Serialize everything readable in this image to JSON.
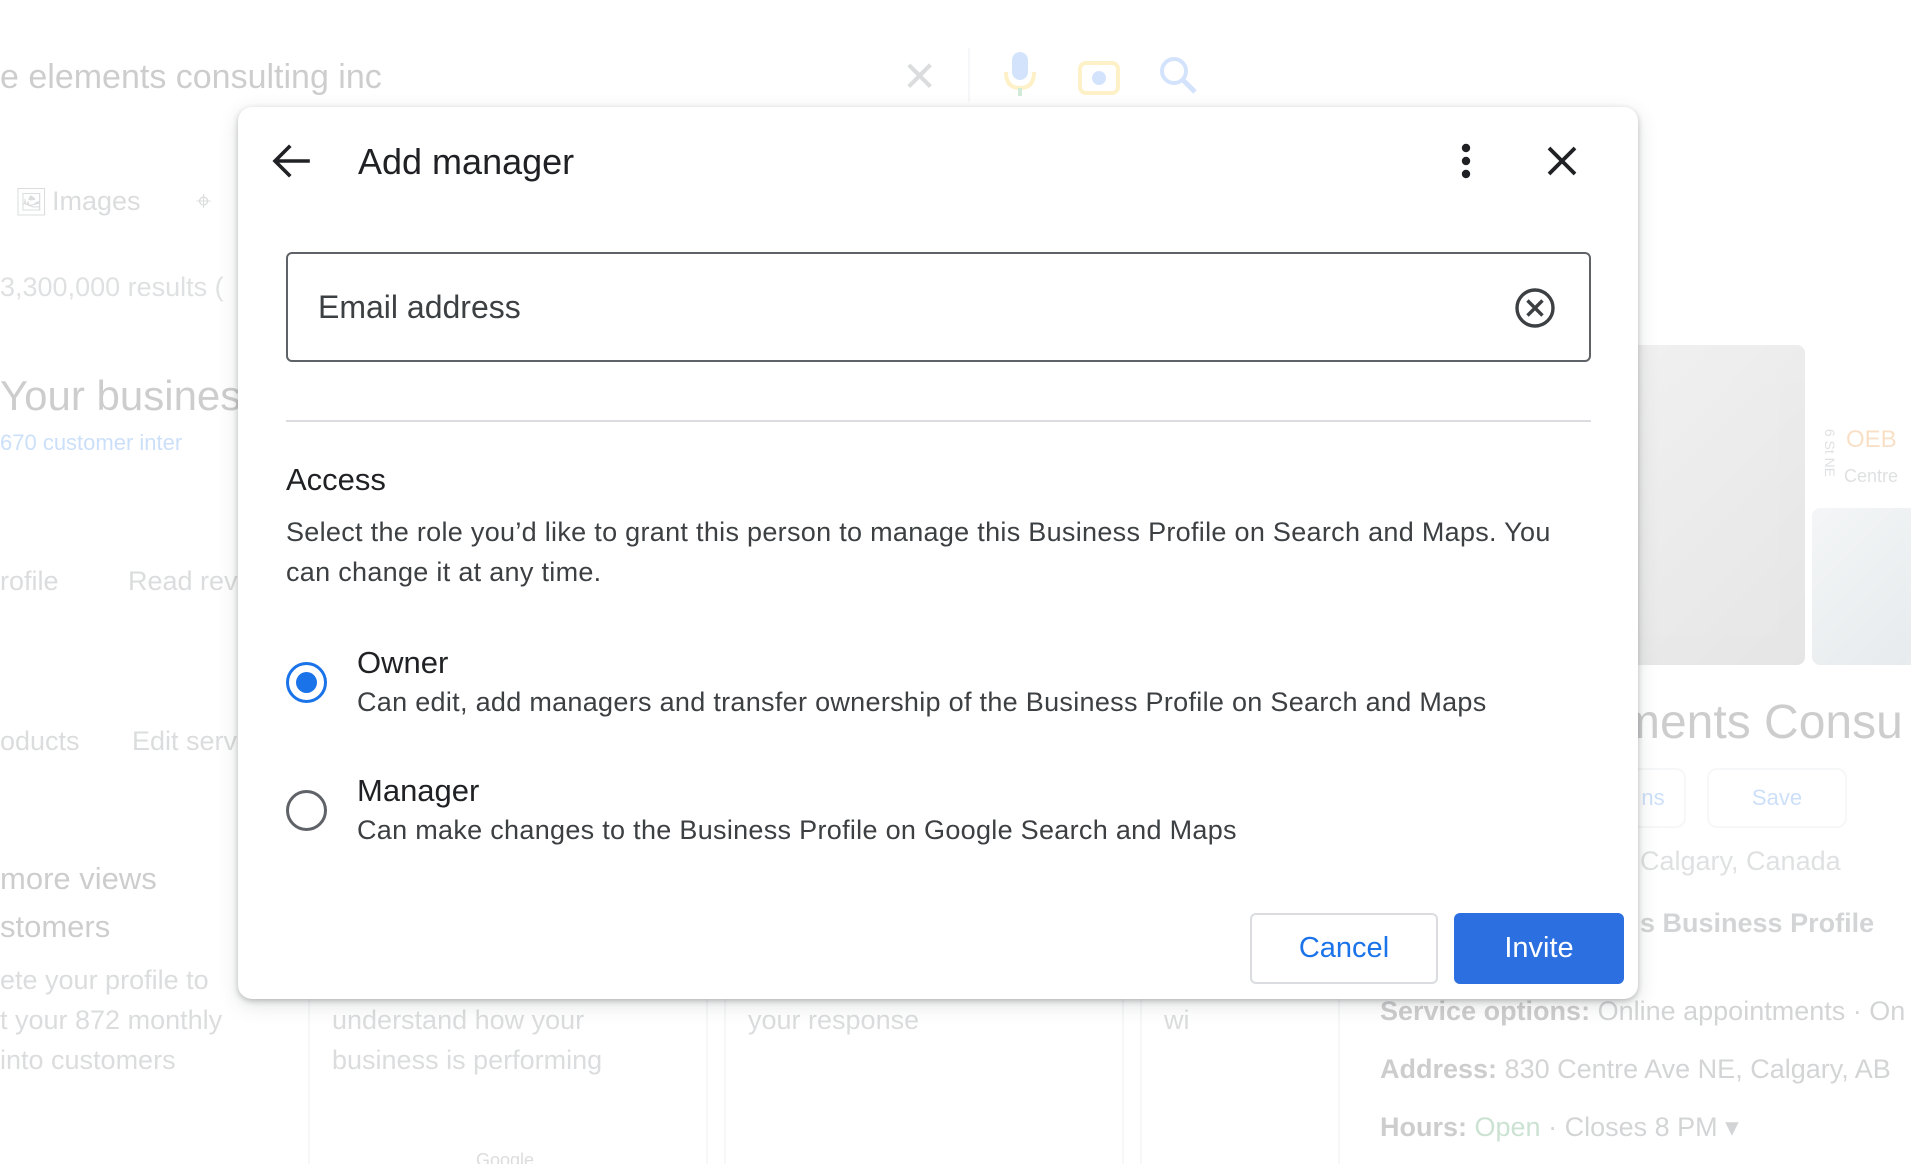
{
  "background": {
    "search_text": "e elements consulting inc",
    "tabs": [
      "Images"
    ],
    "results_text": "3,300,000 results (",
    "heading": "Your business",
    "interactions_text": "670 customer inter",
    "actions": [
      "rofile",
      "Read rev",
      "oducts",
      "Edit serv"
    ],
    "promo_lines": [
      "more views",
      "stomers"
    ],
    "promo_desc": [
      "ete your profile to",
      "t your 872 monthly",
      "into customers"
    ],
    "card_texts": [
      "understand how your",
      "business is performing",
      "your response",
      "wi"
    ],
    "footer_logo": "Google",
    "panel_title": "ments Consu",
    "panel_label_1": "OEB",
    "panel_label_2": "Centre",
    "panel_street": "6 St NE",
    "panel_buttons": [
      "ns",
      "Save"
    ],
    "panel_location": "Calgary, Canada",
    "panel_profile": "s Business Profile",
    "service_label": "Service options:",
    "service_value": "Online appointments · On",
    "address_label": "Address:",
    "address_value": "830 Centre Ave NE, Calgary, AB",
    "hours_label": "Hours:",
    "hours_open": "Open",
    "hours_value": "· Closes 8 PM ▾"
  },
  "dialog": {
    "title": "Add manager",
    "back_icon": "arrow-left-icon",
    "more_icon": "more-vert-icon",
    "close_icon": "close-icon",
    "email": {
      "placeholder": "Email address",
      "value": "",
      "clear_icon": "cancel-circle-icon"
    },
    "access": {
      "heading": "Access",
      "description": "Select the role you’d like to grant this person to manage this Business Profile on Search and Maps. You can change it at any time."
    },
    "roles": [
      {
        "label": "Owner",
        "description": "Can edit, add managers and transfer ownership of the Business Profile on Search and Maps",
        "selected": true
      },
      {
        "label": "Manager",
        "description": "Can make changes to the Business Profile on Google Search and Maps",
        "selected": false
      }
    ],
    "cancel_label": "Cancel",
    "invite_label": "Invite"
  },
  "colors": {
    "accent": "#1a73e8",
    "invite_bg": "#2c6fe0"
  }
}
